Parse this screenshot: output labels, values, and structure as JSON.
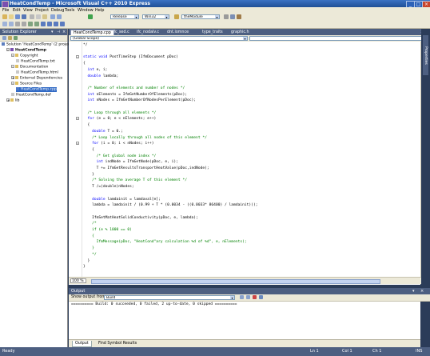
{
  "window": {
    "title": "HeatCondTemp - Microsoft Visual C++ 2010 Express"
  },
  "menu": [
    "File",
    "Edit",
    "View",
    "Project",
    "Debug",
    "Tools",
    "Window",
    "Help"
  ],
  "toolbar": {
    "config": "Release",
    "platform": "Win32",
    "find": "theModule"
  },
  "solution_explorer": {
    "title": "Solution Explorer",
    "items": [
      {
        "label": "Solution 'HeatCondTemp' (2 project",
        "level": 0,
        "expander": ""
      },
      {
        "label": "HeatCondTemp",
        "level": 1,
        "expander": "-",
        "bold": true
      },
      {
        "label": "Copyright",
        "level": 2,
        "expander": "-"
      },
      {
        "label": "HeatCondTemp.txt",
        "level": 3,
        "expander": ""
      },
      {
        "label": "Documentation",
        "level": 2,
        "expander": "-"
      },
      {
        "label": "HeatCondTemp.html",
        "level": 3,
        "expander": ""
      },
      {
        "label": "External Dependencies",
        "level": 2,
        "expander": "+"
      },
      {
        "label": "Source Files",
        "level": 2,
        "expander": "-"
      },
      {
        "label": "HeatCondTemp.cpp",
        "level": 3,
        "expander": "",
        "selected": true
      },
      {
        "label": "HeatCondTemp.def",
        "level": 2,
        "expander": ""
      },
      {
        "label": "lib",
        "level": 1,
        "expander": "+"
      }
    ]
  },
  "tabs": [
    {
      "label": "HeatCondTemp.cpp",
      "active": true
    },
    {
      "label": "ifc_sed.c"
    },
    {
      "label": "ifc_nodalv.c"
    },
    {
      "label": "dnt.iomnce"
    },
    {
      "label": "type_traits"
    },
    {
      "label": "graphic.h"
    }
  ],
  "editor": {
    "scope": "(Global Scope)",
    "zoom": "100 %",
    "lines": [
      [
        [
          "tx",
          "*/"
        ]
      ],
      [],
      [
        [
          "kw",
          "static void "
        ],
        [
          "tx",
          "PostTimeStep (IfmDocument pDoc)"
        ]
      ],
      [
        [
          "tx",
          "{"
        ]
      ],
      [
        [
          "kw",
          "  int "
        ],
        [
          "tx",
          "e, i;"
        ]
      ],
      [
        [
          "kw",
          "  double "
        ],
        [
          "tx",
          "lambda;"
        ]
      ],
      [],
      [
        [
          "cm",
          "  /* Number of elements and number of nodes */"
        ]
      ],
      [
        [
          "kw",
          "  int "
        ],
        [
          "tx",
          "nElements = IfmGetNumberOfElements(pDoc);"
        ]
      ],
      [
        [
          "kw",
          "  int "
        ],
        [
          "tx",
          "nNodes = IfmGetNumberOfNodesPerElement(pDoc);"
        ]
      ],
      [],
      [
        [
          "cm",
          "  /* Loop through all elements */"
        ]
      ],
      [
        [
          "kw",
          "  for "
        ],
        [
          "tx",
          "(e = 0; e < nElements; e++)"
        ]
      ],
      [
        [
          "tx",
          "  {"
        ]
      ],
      [
        [
          "kw",
          "    double "
        ],
        [
          "tx",
          "T = 0.;"
        ]
      ],
      [
        [
          "cm",
          "    /* Loop locally through all nodes of this element */"
        ]
      ],
      [
        [
          "kw",
          "    for "
        ],
        [
          "tx",
          "(i = 0; i < nNodes; i++)"
        ]
      ],
      [
        [
          "tx",
          "    {"
        ]
      ],
      [
        [
          "cm",
          "      /* Get global node index */"
        ]
      ],
      [
        [
          "kw",
          "      int "
        ],
        [
          "tx",
          "indNode = IfmGetNode(pDoc, e, i);"
        ]
      ],
      [
        [
          "tx",
          "      T += IfmGetResultsTransportHeatValue(pDoc,indNode);"
        ]
      ],
      [
        [
          "tx",
          "    }"
        ]
      ],
      [
        [
          "cm",
          "    /* Solving the average T of this element */"
        ]
      ],
      [
        [
          "tx",
          "    T /=(double)nNodes;"
        ]
      ],
      [],
      [
        [
          "kw",
          "    double "
        ],
        [
          "tx",
          "lamdainit = lamdaval[e];"
        ]
      ],
      [
        [
          "tx",
          "    lambda = lamdainit / (0.99 + T * (0.0034 - ((0.0033* 86400) / lamdainit)));"
        ]
      ],
      [],
      [
        [
          "tx",
          "    IfmSetMatHeatSolidConductivity(pDoc, e, lambda);"
        ]
      ],
      [
        [
          "cm",
          "    /*"
        ]
      ],
      [
        [
          "cm",
          "    if (e % 1000 == 0)"
        ]
      ],
      [
        [
          "cm",
          "    {"
        ]
      ],
      [
        [
          "cm",
          "      IfmMessage(pDoc, \"HeatCond\"ary calculation %d of %d\", e, nElements);"
        ]
      ],
      [
        [
          "cm",
          "    }"
        ]
      ],
      [
        [
          "cm",
          "    */"
        ]
      ],
      [
        [
          "tx",
          "  }"
        ]
      ],
      [
        [
          "tx",
          "}"
        ]
      ]
    ]
  },
  "output": {
    "title": "Output",
    "show_from_label": "Show output from:",
    "show_from_value": "Build",
    "text": "========== Build: 0 succeeded, 0 failed, 2 up-to-date, 0 skipped ==========",
    "tabs": [
      "Output",
      "Find Symbol Results"
    ]
  },
  "status": {
    "state": "Ready",
    "ln": "Ln 1",
    "col": "Col 1",
    "ch": "Ch 1",
    "mode": "INS"
  },
  "right_strip_label": "Properties"
}
